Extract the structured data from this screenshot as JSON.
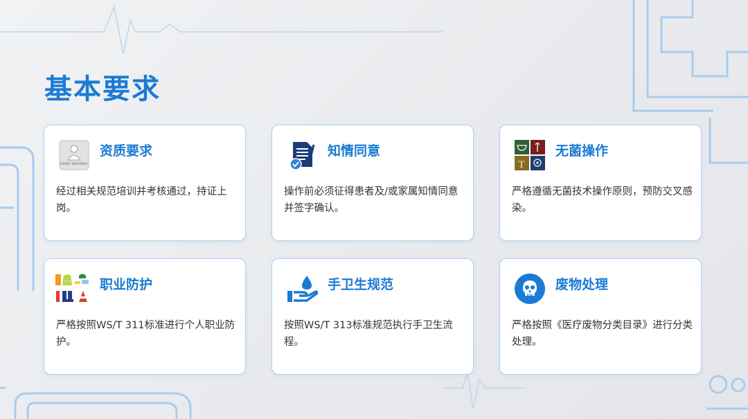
{
  "slide": {
    "title": "基本要求",
    "accent_color": "#1a7bd4",
    "border_color": "#a9d2f3"
  },
  "cards": [
    {
      "title": "资质要求",
      "text": "经过相关规范培训并考核通过，持证上岗。",
      "icon": "staff-training-icon",
      "icon_caption": "STAFF TRAINING"
    },
    {
      "title": "知情同意",
      "text": "操作前必须征得患者及/或家属知情同意并签字确认。",
      "icon": "consent-document-icon"
    },
    {
      "title": "无菌操作",
      "text": "严格遵循无菌技术操作原则，预防交叉感染。",
      "icon": "sterile-operation-icon",
      "icon_caption": "T"
    },
    {
      "title": "职业防护",
      "text": "严格按照WS/T 311标准进行个人职业防护。",
      "icon": "protective-equipment-icon"
    },
    {
      "title": "手卫生规范",
      "text": "按照WS/T 313标准规范执行手卫生流程。",
      "icon": "hand-hygiene-icon"
    },
    {
      "title": "废物处理",
      "text": "严格按照《医疗废物分类目录》进行分类处理。",
      "icon": "waste-skull-icon"
    }
  ]
}
